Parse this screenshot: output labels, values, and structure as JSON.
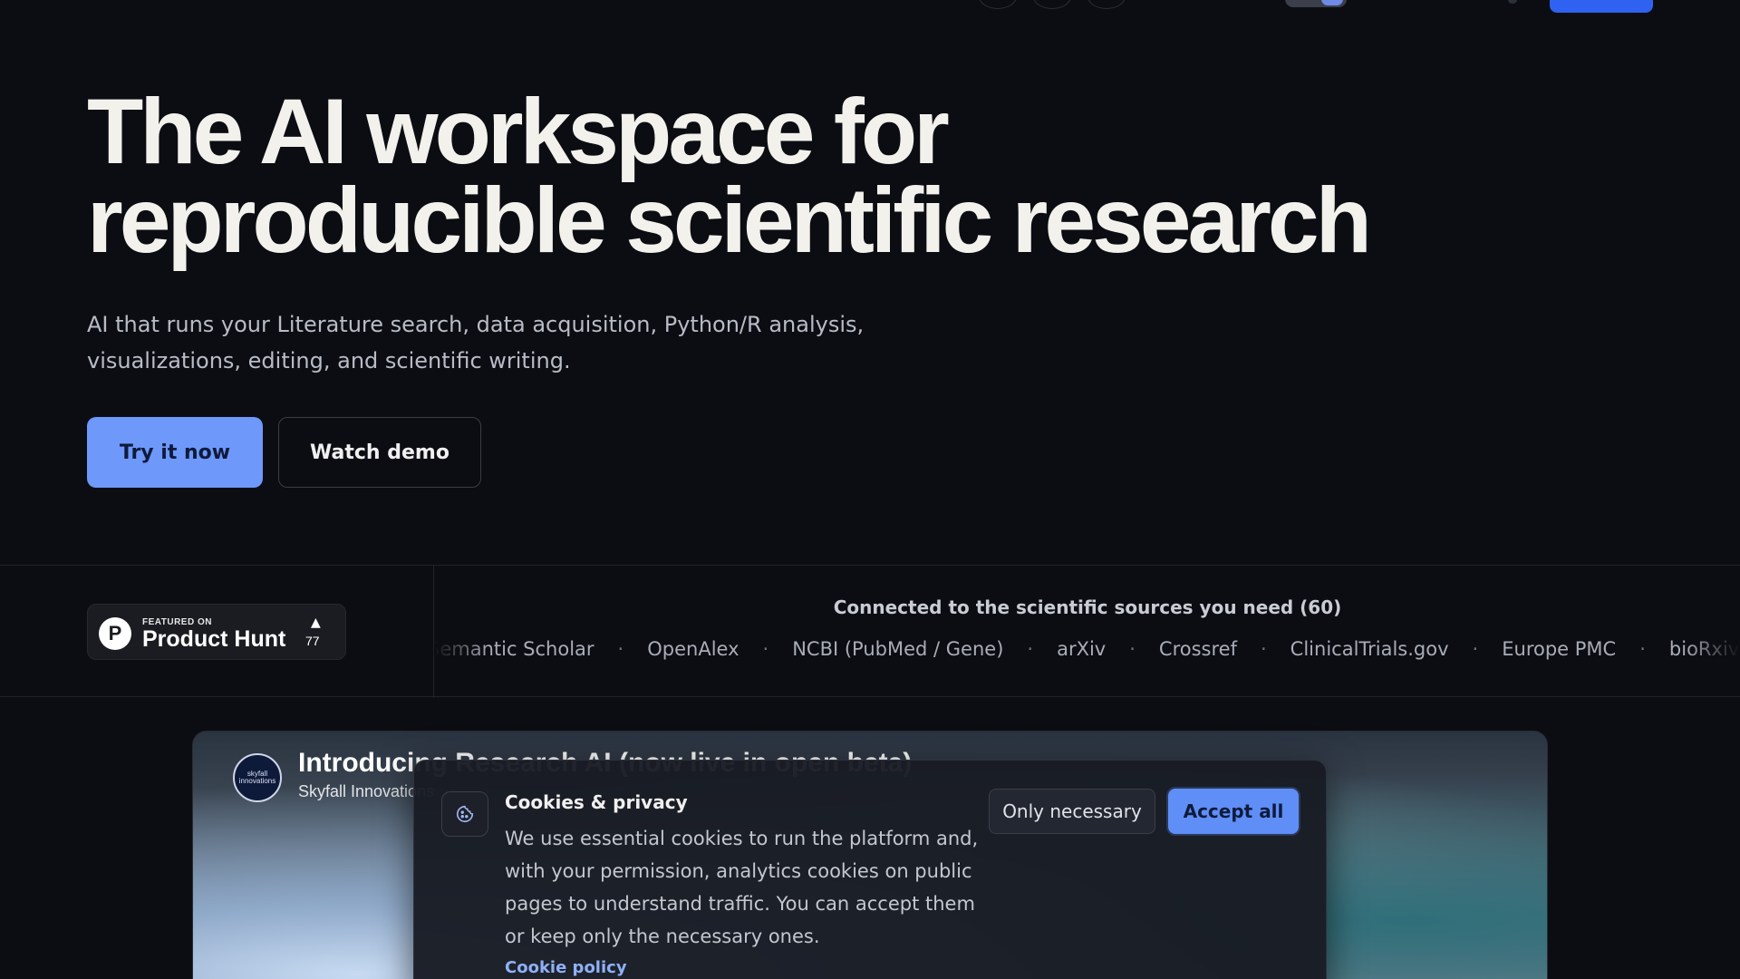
{
  "hero": {
    "title_line1": "The AI workspace for",
    "title_line2": "reproducible scientific research",
    "subtitle_line1": "AI that runs your Literature search, data acquisition, Python/R analysis,",
    "subtitle_line2": "visualizations, editing, and scientific writing.",
    "primary_button": "Try it now",
    "secondary_button": "Watch demo"
  },
  "product_hunt": {
    "logo_letter": "P",
    "featured_label": "FEATURED ON",
    "name": "Product Hunt",
    "upvote_arrow": "▲",
    "upvote_count": "77"
  },
  "sources": {
    "heading": "Connected to the scientific sources you need (60)",
    "items": [
      "Semantic Scholar",
      "OpenAlex",
      "NCBI (PubMed / Gene)",
      "arXiv",
      "Crossref",
      "ClinicalTrials.gov",
      "Europe PMC",
      "bioRxiv /"
    ],
    "separator": "·"
  },
  "video": {
    "avatar_text": "skyfall innovations",
    "title": "Introducing Research AI (now live in open beta)",
    "channel": "Skyfall Innovations"
  },
  "cookie": {
    "title": "Cookies & privacy",
    "text": "We use essential cookies to run the platform and, with your permission, analytics cookies on public pages to understand traffic. You can accept them or keep only the necessary ones.",
    "link": "Cookie policy",
    "only_necessary": "Only necessary",
    "accept_all": "Accept all"
  },
  "colors": {
    "background": "#0b0d12",
    "primary_button": "#6f98fb",
    "accent_blue": "#2f62f0",
    "link": "#8fb0f7"
  }
}
